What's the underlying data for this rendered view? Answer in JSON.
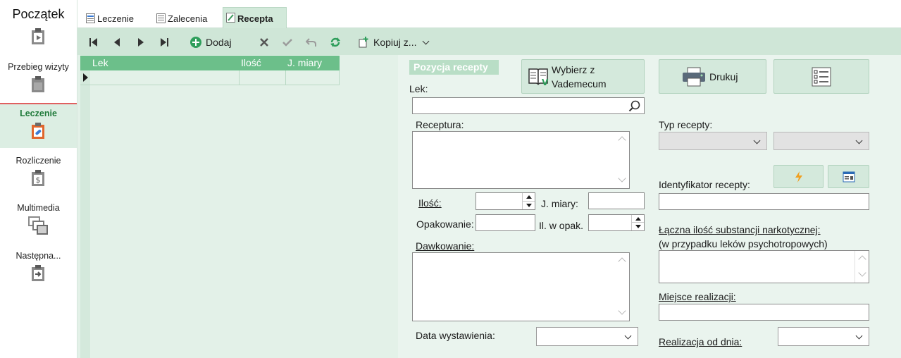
{
  "leftnav": {
    "home_label": "Początek",
    "items": [
      {
        "label": "Przebieg wizyty",
        "icon": "clipboard-icon"
      },
      {
        "label": "Leczenie",
        "icon": "clipboard-medical-icon",
        "active": true
      },
      {
        "label": "Rozliczenie",
        "icon": "clipboard-dollar-icon"
      },
      {
        "label": "Multimedia",
        "icon": "images-icon"
      },
      {
        "label": "Następna...",
        "icon": "clipboard-arrow-icon"
      }
    ]
  },
  "tabs": [
    {
      "label": "Leczenie"
    },
    {
      "label": "Zalecenia"
    },
    {
      "label": "Recepta",
      "active": true
    }
  ],
  "toolbar": {
    "add_label": "Dodaj",
    "copy_label": "Kopiuj z..."
  },
  "grid": {
    "columns": [
      "Lek",
      "Ilość",
      "J. miary"
    ]
  },
  "form": {
    "section_title": "Pozycja recepty",
    "vademecum_label_1": "Wybierz z",
    "vademecum_label_2": "Vademecum",
    "print_label": "Drukuj",
    "lek_label": "Lek:",
    "receptura_label": "Receptura:",
    "ilosc_label": "Ilość:",
    "jm_label": "J. miary:",
    "opakowanie_label": "Opakowanie:",
    "ilwopak_label": "Il. w opak.",
    "dawkowanie_label": "Dawkowanie:",
    "data_label": "Data wystawienia:",
    "typ_label": "Typ recepty:",
    "ident_label": "Identyfikator recepty:",
    "narko_label_1": "Łączna ilość substancji narkotycznej:",
    "narko_label_2": "(w przypadku leków psychotropowych)",
    "miejsce_label": "Miejsce realizacji:",
    "realizacja_label": "Realizacja od dnia:"
  },
  "colors": {
    "accent": "#6cbf8a",
    "active_nav_text": "#1f7a3a",
    "panel_bg": "#eaf4ee"
  }
}
